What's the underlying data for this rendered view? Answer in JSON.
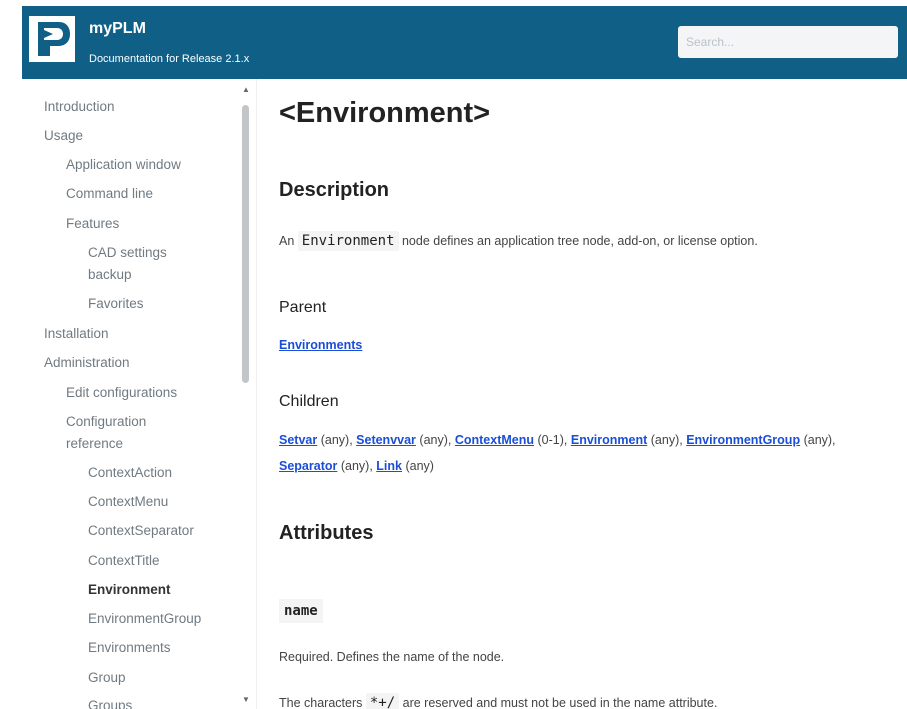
{
  "header": {
    "title": "myPLM",
    "subtitle": "Documentation for Release 2.1.x",
    "search_placeholder": "Search..."
  },
  "sidebar": {
    "items": [
      {
        "label": "Introduction",
        "level": 0
      },
      {
        "label": "Usage",
        "level": 0
      },
      {
        "label": "Application window",
        "level": 1
      },
      {
        "label": "Command line",
        "level": 1
      },
      {
        "label": "Features",
        "level": 1
      },
      {
        "label": "CAD settings",
        "level": 2
      },
      {
        "label": "backup",
        "level": 2
      },
      {
        "label": "Favorites",
        "level": 2
      },
      {
        "label": "Installation",
        "level": 0
      },
      {
        "label": "Administration",
        "level": 0
      },
      {
        "label": "Edit configurations",
        "level": 1
      },
      {
        "label": "Configuration",
        "level": 1
      },
      {
        "label": "reference",
        "level": 1
      },
      {
        "label": "ContextAction",
        "level": 2
      },
      {
        "label": "ContextMenu",
        "level": 2
      },
      {
        "label": "ContextSeparator",
        "level": 2
      },
      {
        "label": "ContextTitle",
        "level": 2
      },
      {
        "label": "Environment",
        "level": 2,
        "active": true
      },
      {
        "label": "EnvironmentGroup",
        "level": 2
      },
      {
        "label": "Environments",
        "level": 2
      },
      {
        "label": "Group",
        "level": 2
      },
      {
        "label": "Groups",
        "level": 2
      }
    ]
  },
  "main": {
    "title": "<Environment>",
    "description_heading": "Description",
    "description": {
      "prefix": "An",
      "code": "Environment",
      "suffix": "node defines an application tree node, add-on, or license option."
    },
    "parent_heading": "Parent",
    "parent_link": "Environments",
    "children_heading": "Children",
    "children": [
      {
        "name": "Setvar",
        "count": "(any),"
      },
      {
        "name": "Setenvvar",
        "count": "(any),"
      },
      {
        "name": "ContextMenu",
        "count": "(0-1),"
      },
      {
        "name": "Environment",
        "count": "(any),"
      },
      {
        "name": "EnvironmentGroup",
        "count": "(any),"
      },
      {
        "name": "Separator",
        "count": "(any),"
      },
      {
        "name": "Link",
        "count": "(any)"
      }
    ],
    "attributes_heading": "Attributes",
    "attr_name": "name",
    "attr_required": "Required. Defines the name of the node.",
    "reserved": {
      "prefix": "The characters",
      "code": "*+/",
      "suffix": "are reserved and must not be used in the name attribute."
    }
  },
  "colors": {
    "header_bg": "#0f5f86",
    "link": "#1a4ed8"
  }
}
